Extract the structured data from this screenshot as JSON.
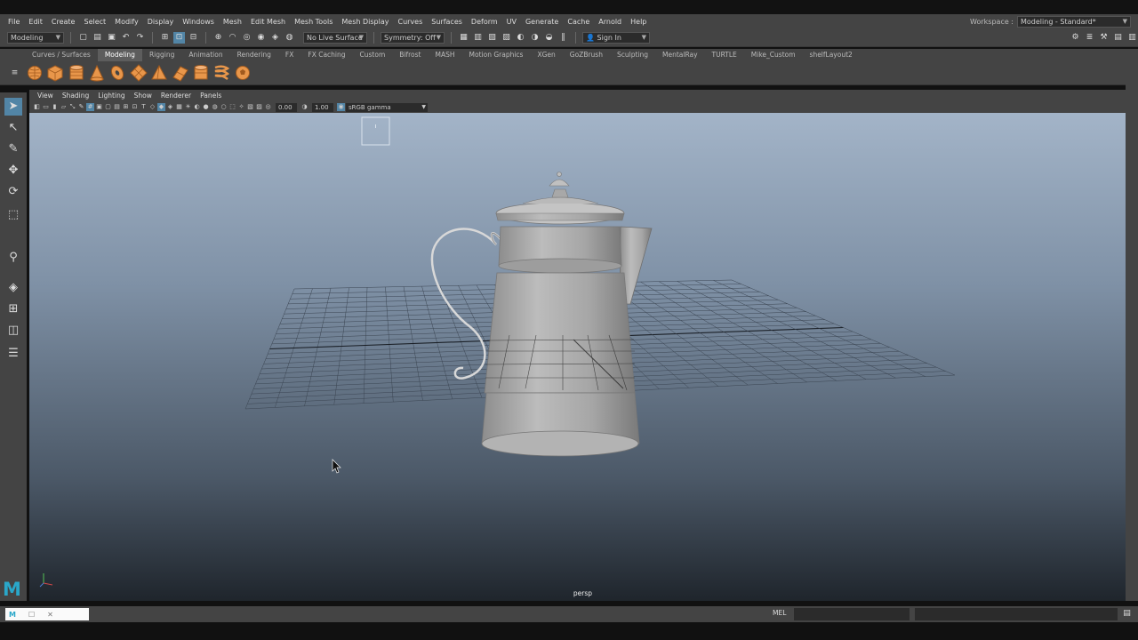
{
  "menubar": {
    "items": [
      "File",
      "Edit",
      "Create",
      "Select",
      "Modify",
      "Display",
      "Windows",
      "Mesh",
      "Edit Mesh",
      "Mesh Tools",
      "Mesh Display",
      "Curves",
      "Surfaces",
      "Deform",
      "UV",
      "Generate",
      "Cache",
      "Arnold",
      "Help"
    ]
  },
  "workspace": {
    "label": "Workspace :",
    "value": "Modeling - Standard*"
  },
  "statusline": {
    "menuset": "Modeling",
    "live_surface": "No Live Surface",
    "symmetry": "Symmetry: Off",
    "sign_in": "Sign In"
  },
  "shelf": {
    "tabs": [
      "Curves / Surfaces",
      "Modeling",
      "Rigging",
      "Animation",
      "Rendering",
      "FX",
      "FX Caching",
      "Custom",
      "Bifrost",
      "MASH",
      "Motion Graphics",
      "XGen",
      "GoZBrush",
      "Sculpting",
      "MentalRay",
      "TURTLE",
      "Mike_Custom",
      "shelfLayout2"
    ],
    "active_tab": "Modeling",
    "primitive_color": "#e8964a"
  },
  "viewport": {
    "menu": [
      "View",
      "Shading",
      "Lighting",
      "Show",
      "Renderer",
      "Panels"
    ],
    "exposure": "0.00",
    "gamma": "1.00",
    "color_space": "sRGB gamma",
    "camera": "persp"
  },
  "cmdline": {
    "mel_label": "MEL"
  },
  "colors": {
    "accent": "#5285a6",
    "panel": "#444444",
    "field": "#2b2b2b",
    "logo": "#2aa7c9"
  }
}
